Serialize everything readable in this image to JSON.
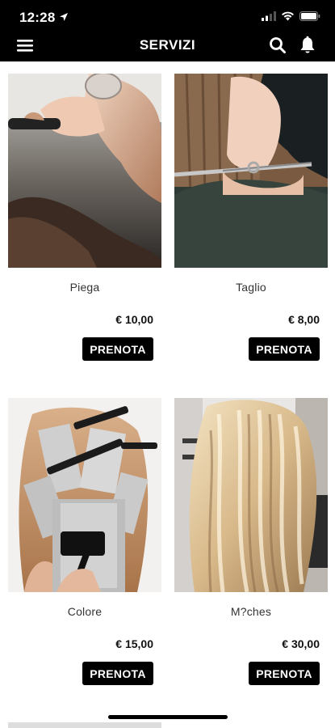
{
  "status_bar": {
    "time": "12:28",
    "icons": [
      "location-arrow-icon",
      "signal-icon",
      "wifi-icon",
      "battery-icon"
    ]
  },
  "header": {
    "title": "SERVIZI",
    "icons": [
      "menu-icon",
      "search-icon",
      "bell-icon"
    ]
  },
  "services": [
    {
      "name": "Piega",
      "price": "€ 10,00",
      "button": "PRENOTA"
    },
    {
      "name": "Taglio",
      "price": "€ 8,00",
      "button": "PRENOTA"
    },
    {
      "name": "Colore",
      "price": "€ 15,00",
      "button": "PRENOTA"
    },
    {
      "name": "M?ches",
      "price": "€ 30,00",
      "button": "PRENOTA"
    }
  ],
  "colors": {
    "bar": "#000000",
    "button_bg": "#000000",
    "button_text": "#ffffff"
  }
}
